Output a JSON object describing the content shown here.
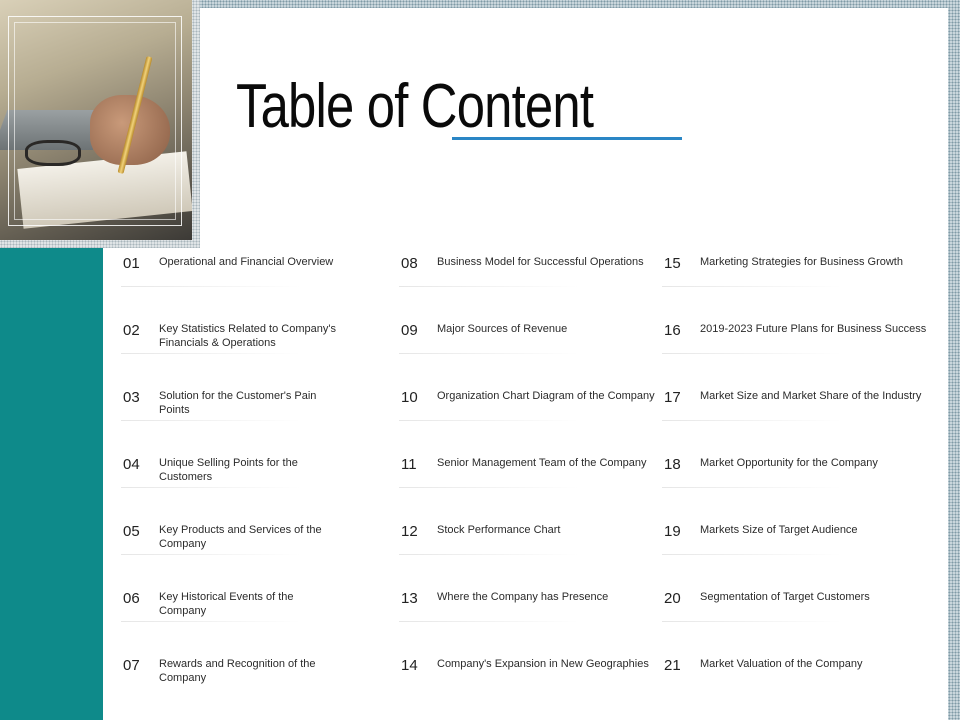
{
  "title": "Table of Content",
  "colors": {
    "teal": "#0e8a8a",
    "accent_underline": "#2a86c5",
    "number_highlight": "#f5b961"
  },
  "columns": [
    [
      {
        "num": "01",
        "text": "Operational and Financial Overview"
      },
      {
        "num": "02",
        "text": "Key Statistics Related to Company's Financials & Operations"
      },
      {
        "num": "03",
        "text": "Solution for the Customer's Pain Points"
      },
      {
        "num": "04",
        "text": "Unique Selling Points for the Customers"
      },
      {
        "num": "05",
        "text": "Key Products and Services of the Company"
      },
      {
        "num": "06",
        "text": "Key Historical Events of the Company"
      },
      {
        "num": "07",
        "text": "Rewards and Recognition of the Company"
      }
    ],
    [
      {
        "num": "08",
        "text": "Business Model for Successful Operations"
      },
      {
        "num": "09",
        "text": "Major Sources of Revenue"
      },
      {
        "num": "10",
        "text": "Organization Chart Diagram of the Company"
      },
      {
        "num": "11",
        "text": "Senior Management Team of the Company"
      },
      {
        "num": "12",
        "text": "Stock Performance Chart"
      },
      {
        "num": "13",
        "text": "Where the Company has Presence"
      },
      {
        "num": "14",
        "text": "Company's Expansion in New Geographies"
      }
    ],
    [
      {
        "num": "15",
        "text": "Marketing Strategies for Business Growth"
      },
      {
        "num": "16",
        "text": "2019-2023 Future Plans for Business Success"
      },
      {
        "num": "17",
        "text": "Market Size and Market Share of the Industry"
      },
      {
        "num": "18",
        "text": "Market Opportunity for the Company"
      },
      {
        "num": "19",
        "text": "Markets Size of Target Audience"
      },
      {
        "num": "20",
        "text": "Segmentation of Target Customers"
      },
      {
        "num": "21",
        "text": "Market Valuation of the Company"
      }
    ]
  ]
}
